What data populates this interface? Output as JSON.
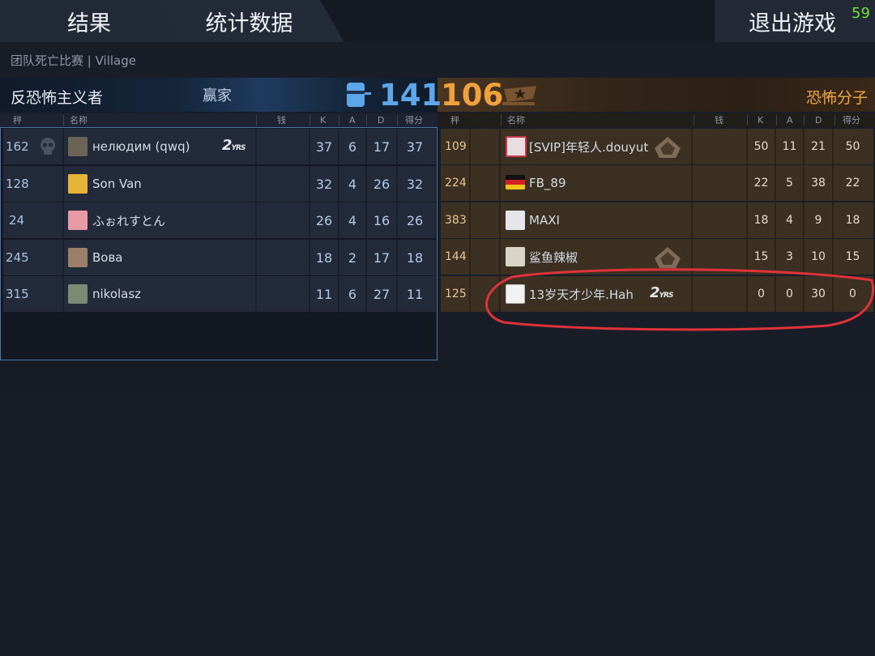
{
  "tabs": {
    "results": "结果",
    "stats": "统计数据",
    "exit": "退出游戏",
    "timer": "59"
  },
  "match": {
    "mode_map": "团队死亡比赛 | Village"
  },
  "teams": {
    "ct": {
      "name": "反恐怖主义者",
      "status": "赢家",
      "score": "141"
    },
    "t": {
      "name": "恐怖分子",
      "score": "106"
    }
  },
  "headers": {
    "rank": "秤",
    "name": "名称",
    "money": "钱",
    "k": "K",
    "a": "A",
    "d": "D",
    "score": "得分"
  },
  "ct_players": [
    {
      "rank": "162",
      "name": "нелюдим (qwq)",
      "k": "37",
      "a": "6",
      "d": "17",
      "score": "37",
      "skull_icon": true,
      "badge": "2yrs"
    },
    {
      "rank": "128",
      "name": "Son Van",
      "k": "32",
      "a": "4",
      "d": "26",
      "score": "32"
    },
    {
      "rank": "24",
      "name": "ふぉれすとん",
      "k": "26",
      "a": "4",
      "d": "16",
      "score": "26"
    },
    {
      "rank": "245",
      "name": "Вова",
      "k": "18",
      "a": "2",
      "d": "17",
      "score": "18"
    },
    {
      "rank": "315",
      "name": "nikolasz",
      "k": "11",
      "a": "6",
      "d": "27",
      "score": "11"
    }
  ],
  "t_players": [
    {
      "rank": "109",
      "name": "[SVIP]年轻人.douyut",
      "k": "50",
      "a": "11",
      "d": "21",
      "score": "50",
      "badge": "rank-emblem"
    },
    {
      "rank": "224",
      "name": "FB_89",
      "k": "22",
      "a": "5",
      "d": "38",
      "score": "22"
    },
    {
      "rank": "383",
      "name": "MAXI",
      "k": "18",
      "a": "4",
      "d": "9",
      "score": "18"
    },
    {
      "rank": "144",
      "name": "鲨鱼辣椒",
      "k": "15",
      "a": "3",
      "d": "10",
      "score": "15",
      "badge": "rank-emblem"
    },
    {
      "rank": "125",
      "name": "13岁天才少年.Hah",
      "k": "0",
      "a": "0",
      "d": "30",
      "score": "0",
      "badge": "2yrs",
      "highlighted": true
    }
  ],
  "colors": {
    "ct_accent": "#5da6ea",
    "t_accent": "#f0a13c",
    "timer": "#6ee03b",
    "highlight": "#e0323a"
  }
}
